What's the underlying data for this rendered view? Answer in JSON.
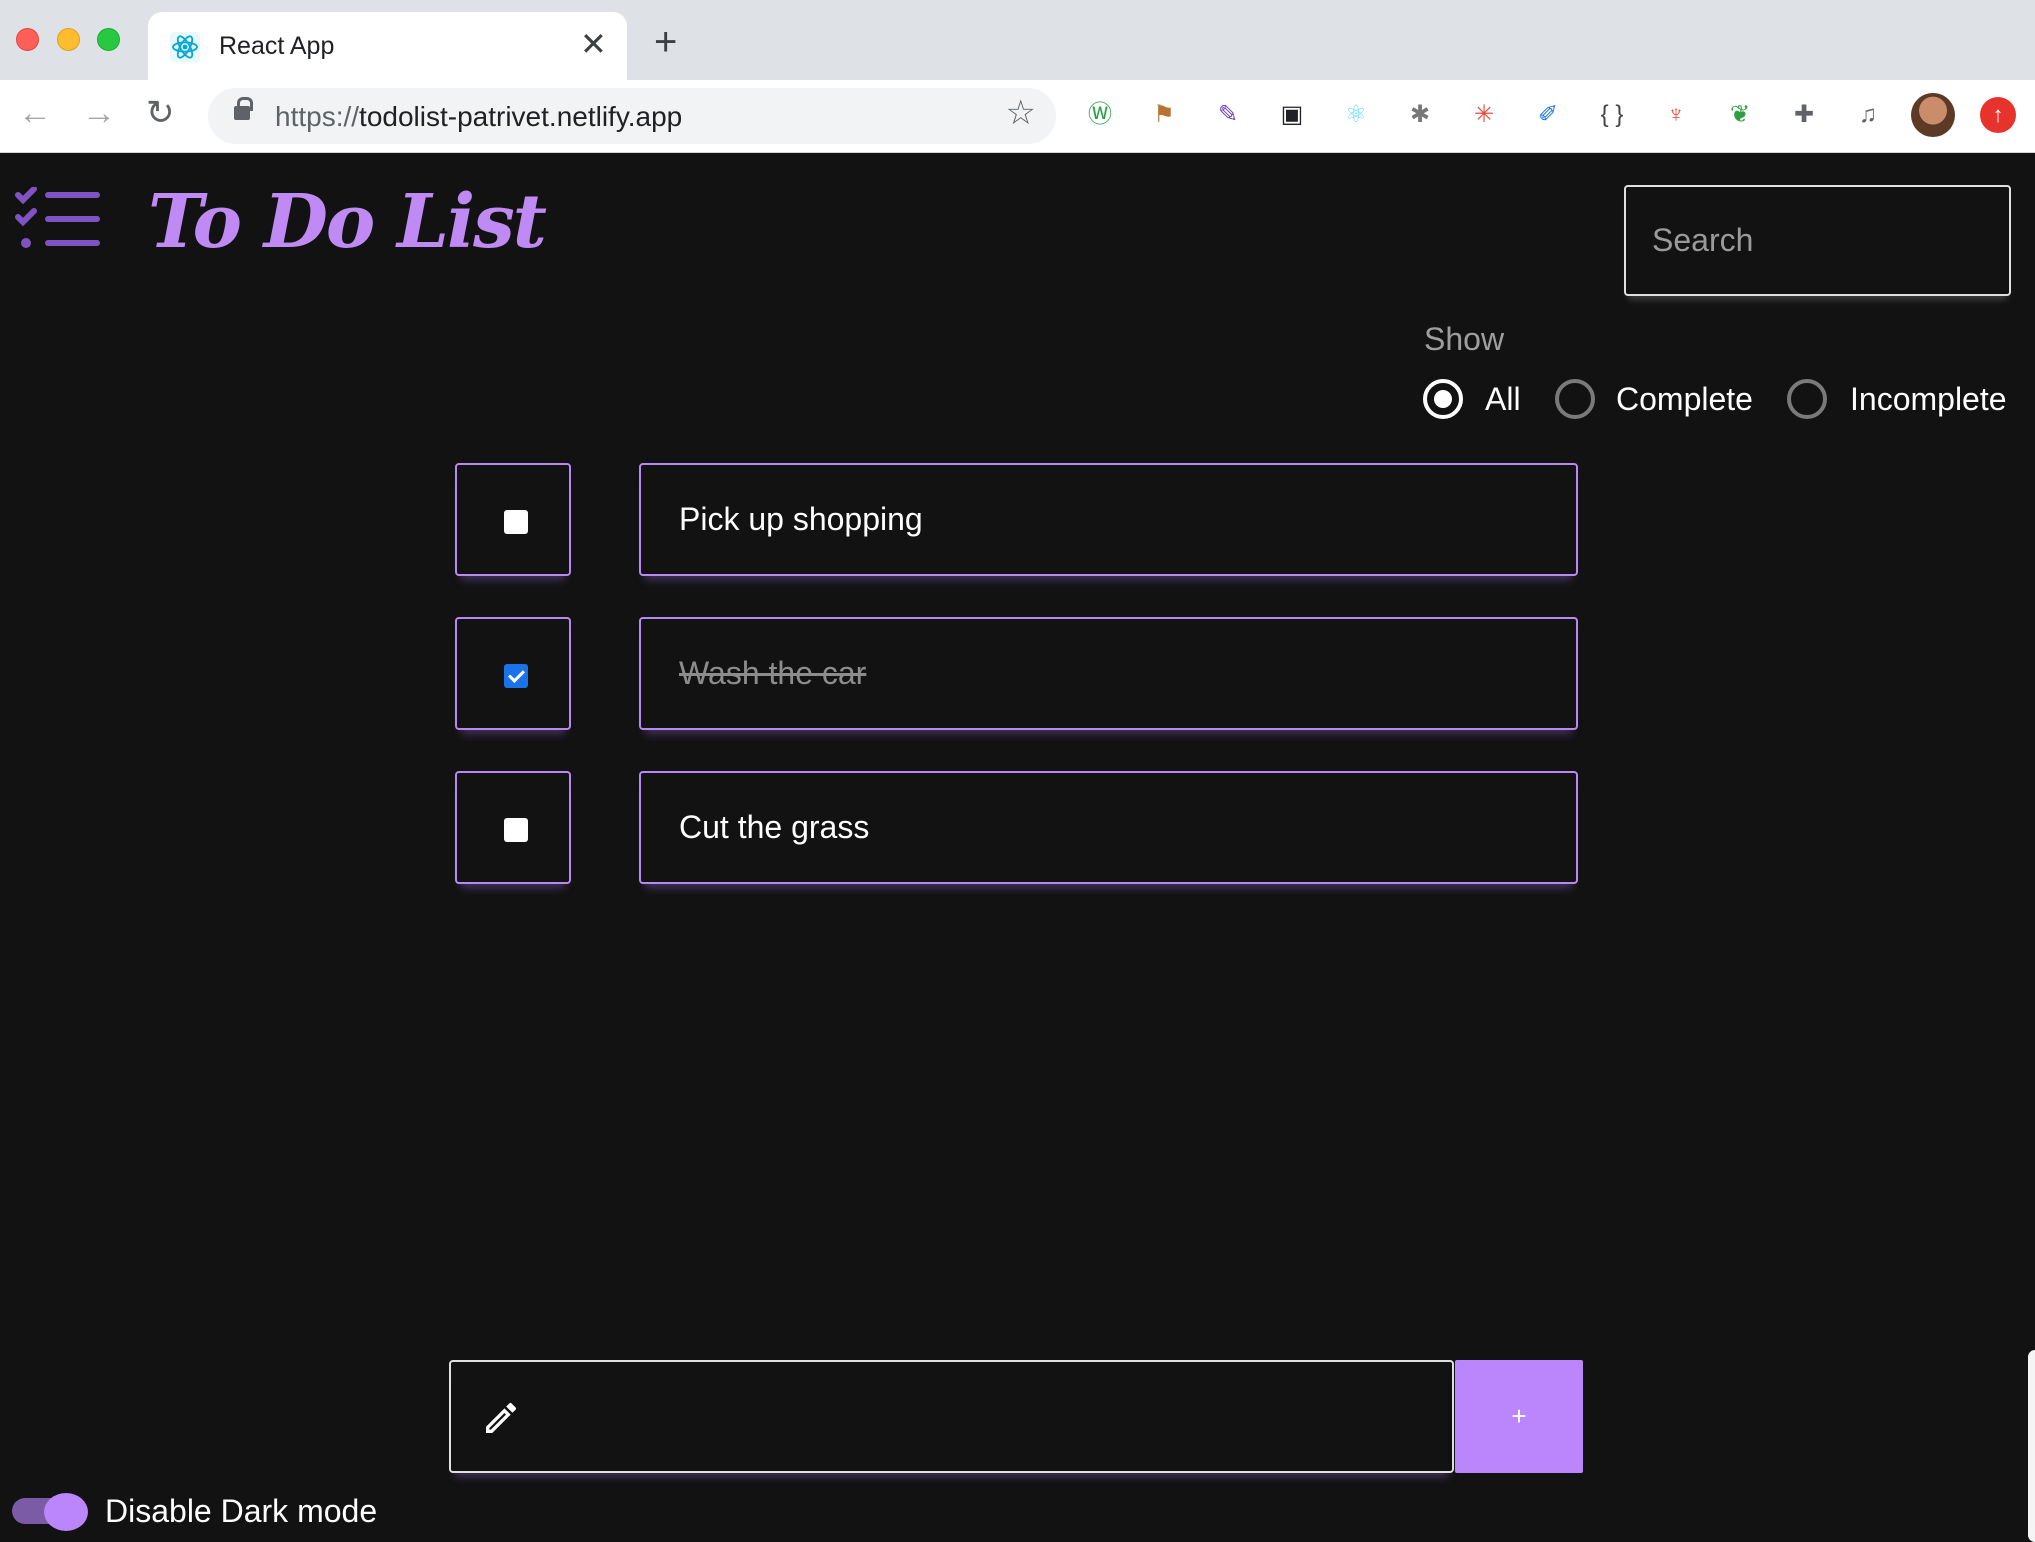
{
  "browser": {
    "tab_title": "React App",
    "new_tab_symbol": "+",
    "close_symbol": "✕",
    "url_scheme": "https://",
    "url_host": "todolist-patrivet.netlify.app",
    "back_symbol": "←",
    "forward_symbol": "→",
    "reload_symbol": "↻",
    "star_symbol": "☆",
    "extensions": [
      {
        "icon": "whatsapp-extension-icon",
        "glyph": "Ⓦ",
        "color": "#25a244"
      },
      {
        "icon": "signpost-extension-icon",
        "glyph": "⚑",
        "color": "#b87333"
      },
      {
        "icon": "eyedropper-extension-icon",
        "glyph": "✎",
        "color": "#6c3fc5"
      },
      {
        "icon": "screenshot-extension-icon",
        "glyph": "▣",
        "color": "#202124"
      },
      {
        "icon": "react-devtools-extension-icon",
        "glyph": "⚛",
        "color": "#61dafb"
      },
      {
        "icon": "bug-extension-icon",
        "glyph": "✱",
        "color": "#777777"
      },
      {
        "icon": "colorful-extension-icon",
        "glyph": "✳",
        "color": "#e94b3c"
      },
      {
        "icon": "color-picker-extension-icon",
        "glyph": "✐",
        "color": "#1a73e8"
      },
      {
        "icon": "json-extension-icon",
        "glyph": "{ }",
        "color": "#444444"
      },
      {
        "icon": "sitemap-extension-icon",
        "glyph": "♆",
        "color": "#e8553c"
      },
      {
        "icon": "leaf-extension-icon",
        "glyph": "❦",
        "color": "#2e9e3e"
      },
      {
        "icon": "puzzle-extensions-icon",
        "glyph": "✚",
        "color": "#5f6368"
      },
      {
        "icon": "media-queue-icon",
        "glyph": "♫",
        "color": "#5f6368"
      }
    ],
    "update_symbol": "↑"
  },
  "app": {
    "title": "To Do List",
    "search_placeholder": "Search",
    "filter": {
      "label": "Show",
      "options": [
        "All",
        "Complete",
        "Incomplete"
      ],
      "selected": "All"
    },
    "tasks": [
      {
        "text": "Pick up shopping",
        "completed": false
      },
      {
        "text": "Wash the car",
        "completed": true
      },
      {
        "text": "Cut the grass",
        "completed": false
      }
    ],
    "new_task_value": "",
    "add_button_label": "+",
    "dark_mode_toggle_label": "Disable Dark mode",
    "dark_mode_enabled": true
  },
  "colors": {
    "accent": "#bb86fc",
    "background": "#121212",
    "text": "#ffffff",
    "muted": "#9e9e9e"
  }
}
